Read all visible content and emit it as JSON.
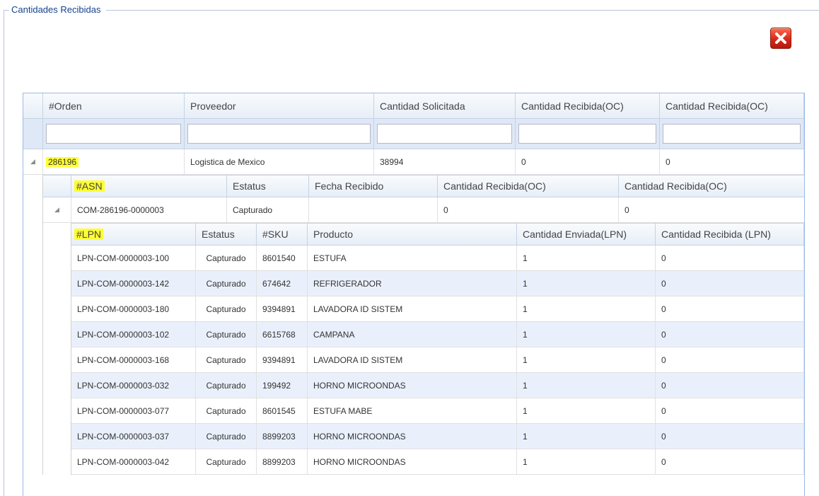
{
  "panel": {
    "legend": "Cantidades Recibidas"
  },
  "orders_grid": {
    "headers": [
      "#Orden",
      "Proveedor",
      "Cantidad Solicitada",
      "Cantidad Recibida(OC)",
      "Cantidad Recibida(OC)"
    ],
    "filter_values": [
      "",
      "",
      "",
      "",
      ""
    ],
    "row": {
      "orden": "286196",
      "proveedor": "Logistica de Mexico",
      "cantidad_solicitada": "38994",
      "cantidad_recibida_1": "0",
      "cantidad_recibida_2": "0"
    }
  },
  "asn_grid": {
    "headers": [
      "#ASN",
      "Estatus",
      "Fecha Recibido",
      "Cantidad Recibida(OC)",
      "Cantidad Recibida(OC)"
    ],
    "row": {
      "asn": "COM-286196-0000003",
      "estatus": "Capturado",
      "fecha_recibido": "",
      "cantidad_recibida_1": "0",
      "cantidad_recibida_2": "0"
    }
  },
  "lpn_grid": {
    "headers": [
      "#LPN",
      "Estatus",
      "#SKU",
      "Producto",
      "Cantidad Enviada(LPN)",
      "Cantidad Recibida (LPN)"
    ],
    "rows": [
      {
        "lpn": "LPN-COM-0000003-100",
        "estatus": "Capturado",
        "sku": "8601540",
        "producto": "ESTUFA",
        "enviada": "1",
        "recibida": "0"
      },
      {
        "lpn": "LPN-COM-0000003-142",
        "estatus": "Capturado",
        "sku": "674642",
        "producto": "REFRIGERADOR",
        "enviada": "1",
        "recibida": "0"
      },
      {
        "lpn": "LPN-COM-0000003-180",
        "estatus": "Capturado",
        "sku": "9394891",
        "producto": "LAVADORA ID SISTEM",
        "enviada": "1",
        "recibida": "0"
      },
      {
        "lpn": "LPN-COM-0000003-102",
        "estatus": "Capturado",
        "sku": "6615768",
        "producto": "CAMPANA",
        "enviada": "1",
        "recibida": "0"
      },
      {
        "lpn": "LPN-COM-0000003-168",
        "estatus": "Capturado",
        "sku": "9394891",
        "producto": "LAVADORA ID SISTEM",
        "enviada": "1",
        "recibida": "0"
      },
      {
        "lpn": "LPN-COM-0000003-032",
        "estatus": "Capturado",
        "sku": "199492",
        "producto": "HORNO MICROONDAS",
        "enviada": "1",
        "recibida": "0"
      },
      {
        "lpn": "LPN-COM-0000003-077",
        "estatus": "Capturado",
        "sku": "8601545",
        "producto": "ESTUFA MABE",
        "enviada": "1",
        "recibida": "0"
      },
      {
        "lpn": "LPN-COM-0000003-037",
        "estatus": "Capturado",
        "sku": "8899203",
        "producto": "HORNO MICROONDAS",
        "enviada": "1",
        "recibida": "0"
      },
      {
        "lpn": "LPN-COM-0000003-042",
        "estatus": "Capturado",
        "sku": "8899203",
        "producto": "HORNO MICROONDAS",
        "enviada": "1",
        "recibida": "0"
      }
    ]
  },
  "icons": {
    "close": "close-icon",
    "expander": "triangle-expanded-icon"
  },
  "colors": {
    "highlight": "#ffff33",
    "close_red": "#d8281a",
    "header_text": "#15428b"
  }
}
